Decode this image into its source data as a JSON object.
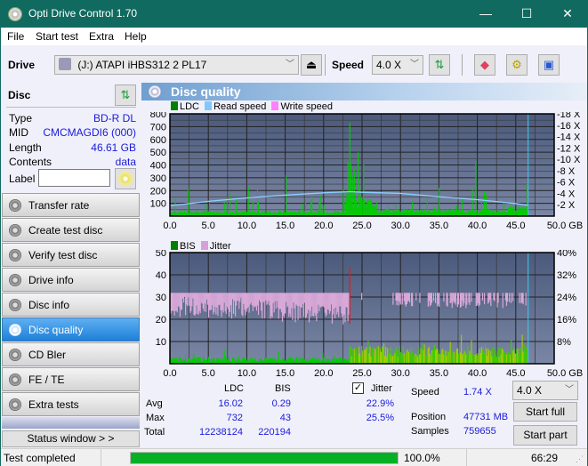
{
  "window": {
    "title": "Opti Drive Control 1.70",
    "minimize": "—",
    "maximize": "☐",
    "close": "✕"
  },
  "menu": [
    "File",
    "Start test",
    "Extra",
    "Help"
  ],
  "toolbar": {
    "drive_label": "Drive",
    "drive_value": "(J:)  ATAPI iHBS312  2 PL17",
    "speed_label": "Speed",
    "speed_value": "4.0 X",
    "icons": [
      "drive-icon",
      "eject-icon",
      "refresh-icon",
      "erase-icon",
      "settings-icon",
      "save-icon"
    ]
  },
  "disc": {
    "header": "Disc",
    "type_k": "Type",
    "type_v": "BD-R DL",
    "mid_k": "MID",
    "mid_v": "CMCMAGDI6 (000)",
    "length_k": "Length",
    "length_v": "46.61 GB",
    "contents_k": "Contents",
    "contents_v": "data",
    "label_k": "Label",
    "label_v": ""
  },
  "nav": [
    {
      "label": "Transfer rate"
    },
    {
      "label": "Create test disc"
    },
    {
      "label": "Verify test disc"
    },
    {
      "label": "Drive info"
    },
    {
      "label": "Disc info"
    },
    {
      "label": "Disc quality",
      "active": true
    },
    {
      "label": "CD Bler"
    },
    {
      "label": "FE / TE"
    },
    {
      "label": "Extra tests"
    }
  ],
  "status_window": "Status window > >",
  "main": {
    "title": "Disc quality"
  },
  "chart_data": [
    {
      "type": "bar",
      "title": "LDC / Read speed",
      "legend": [
        "LDC",
        "Read speed",
        "Write speed"
      ],
      "legend_colors": [
        "#008000",
        "#80c8ff",
        "#ff80ff"
      ],
      "x_ticks": [
        "0.0",
        "5.0",
        "10.0",
        "15.0",
        "20.0",
        "25.0",
        "30.0",
        "35.0",
        "40.0",
        "45.0",
        "50.0 GB"
      ],
      "xlim": [
        0,
        50
      ],
      "y_ticks": [
        "100",
        "200",
        "300",
        "400",
        "500",
        "600",
        "700",
        "800"
      ],
      "ylim": [
        0,
        800
      ],
      "y2_ticks": [
        "2 X",
        "4 X",
        "6 X",
        "8 X",
        "10 X",
        "12 X",
        "14 X",
        "16 X",
        "18 X"
      ],
      "y2lim": [
        0,
        18
      ],
      "ldc_peaks": [
        {
          "x": 23.4,
          "y": 732
        },
        {
          "x": 24.5,
          "y": 500
        },
        {
          "x": 39.8,
          "y": 430
        },
        {
          "x": 15.1,
          "y": 320
        },
        {
          "x": 46.5,
          "y": 250
        }
      ],
      "read_speed": {
        "x": [
          0,
          5,
          10,
          15,
          20,
          23.5,
          25,
          30,
          35,
          40,
          45,
          46.6
        ],
        "y": [
          1.8,
          2.6,
          3.2,
          3.7,
          4.1,
          4.3,
          4.2,
          4.0,
          3.4,
          2.9,
          2.2,
          1.9
        ]
      },
      "end_marker_gb": 46.61
    },
    {
      "type": "bar",
      "title": "BIS / Jitter",
      "legend": [
        "BIS",
        "Jitter"
      ],
      "legend_colors": [
        "#008000",
        "#d8a0d8"
      ],
      "x_ticks": [
        "0.0",
        "5.0",
        "10.0",
        "15.0",
        "20.0",
        "25.0",
        "30.0",
        "35.0",
        "40.0",
        "45.0",
        "50.0 GB"
      ],
      "xlim": [
        0,
        50
      ],
      "y_ticks": [
        "10",
        "20",
        "30",
        "40",
        "50"
      ],
      "ylim": [
        0,
        50
      ],
      "y2_ticks": [
        "8%",
        "16%",
        "24%",
        "32%",
        "40%"
      ],
      "y2lim": [
        0,
        40
      ],
      "jitter": {
        "x": [
          0,
          2,
          5,
          10,
          15,
          20,
          23.4,
          23.5,
          29,
          30,
          35,
          40,
          45,
          46.6
        ],
        "y": [
          24,
          23,
          23,
          22,
          22,
          20,
          19,
          25.5,
          25.5,
          22,
          21,
          21,
          21,
          21
        ]
      },
      "bis_peak": {
        "x": 23.4,
        "y": 43
      }
    }
  ],
  "stats": {
    "col_ldc": "LDC",
    "col_bis": "BIS",
    "jitter_label": "Jitter",
    "jitter_checked": true,
    "avg_label": "Avg",
    "avg_ldc": "16.02",
    "avg_bis": "0.29",
    "avg_jit": "22.9%",
    "max_label": "Max",
    "max_ldc": "732",
    "max_bis": "43",
    "max_jit": "25.5%",
    "total_label": "Total",
    "total_ldc": "12238124",
    "total_bis": "220194",
    "speed_label": "Speed",
    "speed_value": "1.74 X",
    "position_label": "Position",
    "position_value": "47731 MB",
    "samples_label": "Samples",
    "samples_value": "759655",
    "speed_select": "4.0 X",
    "start_full": "Start full",
    "start_part": "Start part"
  },
  "statusbar": {
    "text": "Test completed",
    "progress": 100.0,
    "progress_text": "100.0%",
    "time": "66:29"
  }
}
